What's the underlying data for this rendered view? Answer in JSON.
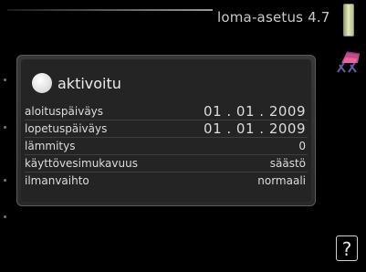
{
  "header": {
    "title": "loma-asetus 4.7"
  },
  "icons": {
    "scroll": "scroll-indicator-icon",
    "holiday": "deck-chair-icon",
    "help": "help-icon"
  },
  "colors": {
    "background": "#000000",
    "panel": "#2a2a2a",
    "text": "#dcdcdc",
    "scroll_accent": "#d8dcae"
  },
  "settings": {
    "activated_label": "aktivoitu",
    "rows": [
      {
        "label": "aloituspäiväys",
        "value": "01 . 01 . 2009"
      },
      {
        "label": "lopetuspäiväys",
        "value": "01 . 01 . 2009"
      },
      {
        "label": "lämmitys",
        "value": "0"
      },
      {
        "label": "käyttövesimukavuus",
        "value": "säästö"
      },
      {
        "label": "ilmanvaihto",
        "value": "normaali"
      }
    ]
  },
  "help": {
    "label": "?"
  }
}
